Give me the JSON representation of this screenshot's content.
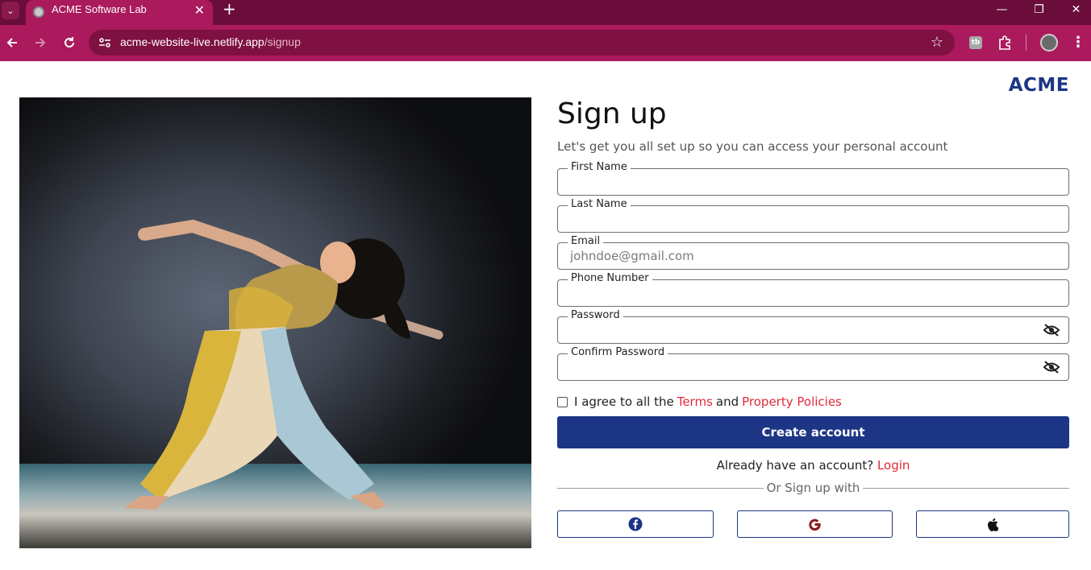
{
  "browser": {
    "tab_title": "ACME Software Lab",
    "tab_close": "✕",
    "new_tab": "+",
    "url_host": "acme-website-live.netlify.app",
    "url_path": "/signup",
    "window_controls": [
      "—",
      "❐",
      "✕"
    ]
  },
  "page": {
    "brand": "ACME",
    "title": "Sign up",
    "subtitle": "Let's get you all set up so you can access your personal account",
    "fields": [
      {
        "label": "First Name",
        "value": "",
        "placeholder": ""
      },
      {
        "label": "Last Name",
        "value": "",
        "placeholder": ""
      },
      {
        "label": "Email",
        "value": "",
        "placeholder": "johndoe@gmail.com"
      },
      {
        "label": "Phone Number",
        "value": "",
        "placeholder": ""
      },
      {
        "label": "Password",
        "value": "",
        "placeholder": ""
      },
      {
        "label": "Confirm Password",
        "value": "",
        "placeholder": ""
      }
    ],
    "terms": {
      "prefix": "I agree to all the",
      "terms_link": "Terms",
      "and": "and",
      "policies_link": "Property Policies",
      "checked": false
    },
    "create_button": "Create account",
    "login_prompt": "Already have an account?",
    "login_link": "Login",
    "divider_text": "Or Sign up with",
    "social": [
      "facebook-icon",
      "google-icon",
      "apple-icon"
    ]
  },
  "colors": {
    "brand_blue": "#1d3585",
    "link_red": "#e02a3a",
    "chrome_dark": "#6a0d3a",
    "chrome_main": "#ab1a5c"
  }
}
